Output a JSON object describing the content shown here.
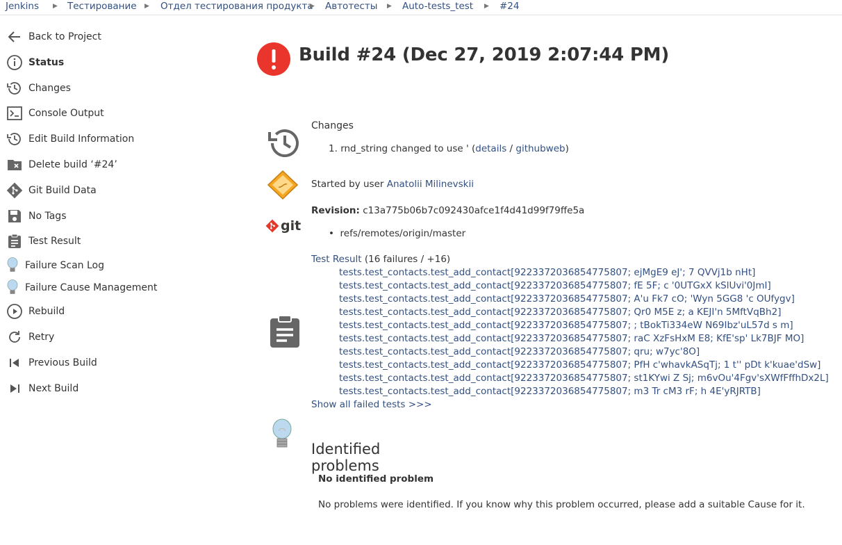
{
  "breadcrumbs": [
    "Jenkins",
    "Тестирование",
    "Отдел тестирования продукта",
    "Автотесты",
    "Auto-tests_test",
    "#24"
  ],
  "sidebar": {
    "items": [
      {
        "label": "Back to Project",
        "icon": "arrow-left-icon"
      },
      {
        "label": "Status",
        "icon": "info-icon"
      },
      {
        "label": "Changes",
        "icon": "history-icon"
      },
      {
        "label": "Console Output",
        "icon": "terminal-icon"
      },
      {
        "label": "Edit Build Information",
        "icon": "history-icon"
      },
      {
        "label": "Delete build ‘#24’",
        "icon": "folder-delete-icon"
      },
      {
        "label": "Git Build Data",
        "icon": "git-icon"
      },
      {
        "label": "No Tags",
        "icon": "save-icon"
      },
      {
        "label": "Test Result",
        "icon": "clipboard-icon"
      },
      {
        "label": "Failure Scan Log",
        "icon": "lightbulb-icon"
      },
      {
        "label": "Failure Cause Management",
        "icon": "lightbulb-icon"
      },
      {
        "label": "Rebuild",
        "icon": "play-circle-icon"
      },
      {
        "label": "Retry",
        "icon": "refresh-icon"
      },
      {
        "label": "Previous Build",
        "icon": "previous-icon"
      },
      {
        "label": "Next Build",
        "icon": "next-icon"
      }
    ]
  },
  "build": {
    "title": "Build #24 (Dec 27, 2019 2:07:44 PM)",
    "status_color": "#e9352c"
  },
  "changes": {
    "heading": "Changes",
    "item_number": "1.",
    "item_text": "rnd_string changed to use ' (",
    "details_link": "details",
    "separator": " / ",
    "githubweb_link": "githubweb",
    "close": ")"
  },
  "started": {
    "prefix": "Started by user ",
    "user": "Anatolii Milinevskii"
  },
  "git": {
    "logo_text": "git",
    "revision_label": "Revision:",
    "revision_value": "c13a775b06b7c092430afce1f4d41d99f79ffe5a",
    "branch": "refs/remotes/origin/master"
  },
  "tests": {
    "link": "Test Result",
    "summary": " (16 failures / +16)",
    "failed": [
      "tests.test_contacts.test_add_contact[9223372036854775807; ejMgE9 eJ'; 7 QVVj1b nHt]",
      "tests.test_contacts.test_add_contact[9223372036854775807; fE 5F; c '0UTGxX kSlUvi'0JmI]",
      "tests.test_contacts.test_add_contact[9223372036854775807; A'u Fk7 cO; 'Wyn 5GG8 'c OUfygv]",
      "tests.test_contacts.test_add_contact[9223372036854775807; Qr0 M5E z; a KEJI'n 5MftVqBh2]",
      "tests.test_contacts.test_add_contact[9223372036854775807; ; tBokTi334eW N69Ibz'uL57d s m]",
      "tests.test_contacts.test_add_contact[9223372036854775807; raC XzFsHxM E8; KfE'sp' Lk7BJF MO]",
      "tests.test_contacts.test_add_contact[9223372036854775807; qru; w7yc'8O]",
      "tests.test_contacts.test_add_contact[9223372036854775807; PfH c'whavkASqTj; 1 t'' pDt k'kuae'dSw]",
      "tests.test_contacts.test_add_contact[9223372036854775807; st1KYwi Z Sj; m6vOu'4Fgv'sXWfFffhDx2L]",
      "tests.test_contacts.test_add_contact[9223372036854775807; m3 Tr cM3 rF; h 4E'yRJRTB]"
    ],
    "show_all": "Show all failed tests >>>"
  },
  "problems": {
    "heading": "Identified problems",
    "subheading": "No identified problem",
    "text": "No problems were identified. If you know why this problem occurred, please add a suitable Cause for it."
  }
}
